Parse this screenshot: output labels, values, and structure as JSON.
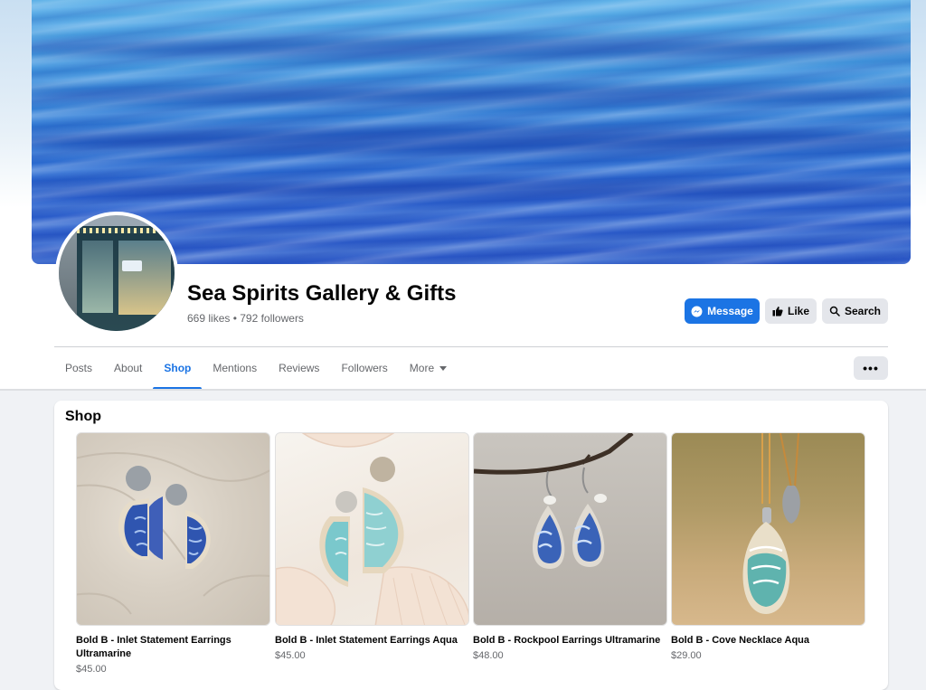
{
  "page": {
    "name": "Sea Spirits Gallery & Gifts",
    "stats": "669 likes • 792 followers"
  },
  "actions": {
    "message": "Message",
    "like": "Like",
    "search": "Search",
    "more": "•••"
  },
  "tabs": [
    {
      "label": "Posts",
      "active": false
    },
    {
      "label": "About",
      "active": false
    },
    {
      "label": "Shop",
      "active": true
    },
    {
      "label": "Mentions",
      "active": false
    },
    {
      "label": "Reviews",
      "active": false
    },
    {
      "label": "Followers",
      "active": false
    },
    {
      "label": "More",
      "active": false
    }
  ],
  "shop": {
    "title": "Shop",
    "products": [
      {
        "name": "Bold B - Inlet Statement Earrings Ultramarine",
        "price": "$45.00"
      },
      {
        "name": "Bold B - Inlet Statement Earrings Aqua",
        "price": "$45.00"
      },
      {
        "name": "Bold B - Rockpool Earrings Ultramarine",
        "price": "$48.00"
      },
      {
        "name": "Bold B - Cove Necklace Aqua",
        "price": "$29.00"
      }
    ]
  },
  "colors": {
    "brand": "#1b74e4",
    "text_secondary": "#65676b",
    "button_grey": "#e4e6eb"
  },
  "icons": {
    "message": "messenger-icon",
    "like": "thumbs-up-icon",
    "search": "search-icon",
    "more": "more-dots-icon",
    "more_tab": "caret-down-icon"
  }
}
